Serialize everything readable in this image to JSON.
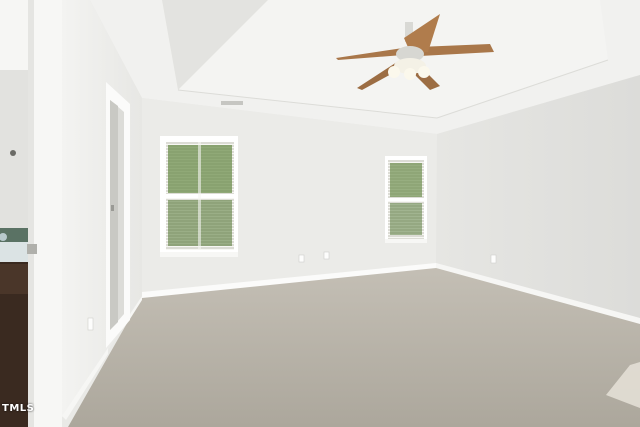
{
  "watermark": {
    "text": "TMLS"
  },
  "palette": {
    "ceiling": "#f1f1ef",
    "back_wall": "#ebebe8",
    "right_wall": "#e4e4e1",
    "left_wall": "#f0f0ed",
    "trim": "#ffffff",
    "carpet": "#b9b4aa",
    "fan_blade": "#a9774a",
    "foliage": "#5b7d3e",
    "cabinet": "#3a2a20"
  },
  "scene_objects": [
    "ceiling-fan-icon",
    "window",
    "doorway",
    "bathroom-vanity",
    "carpet-floor"
  ]
}
